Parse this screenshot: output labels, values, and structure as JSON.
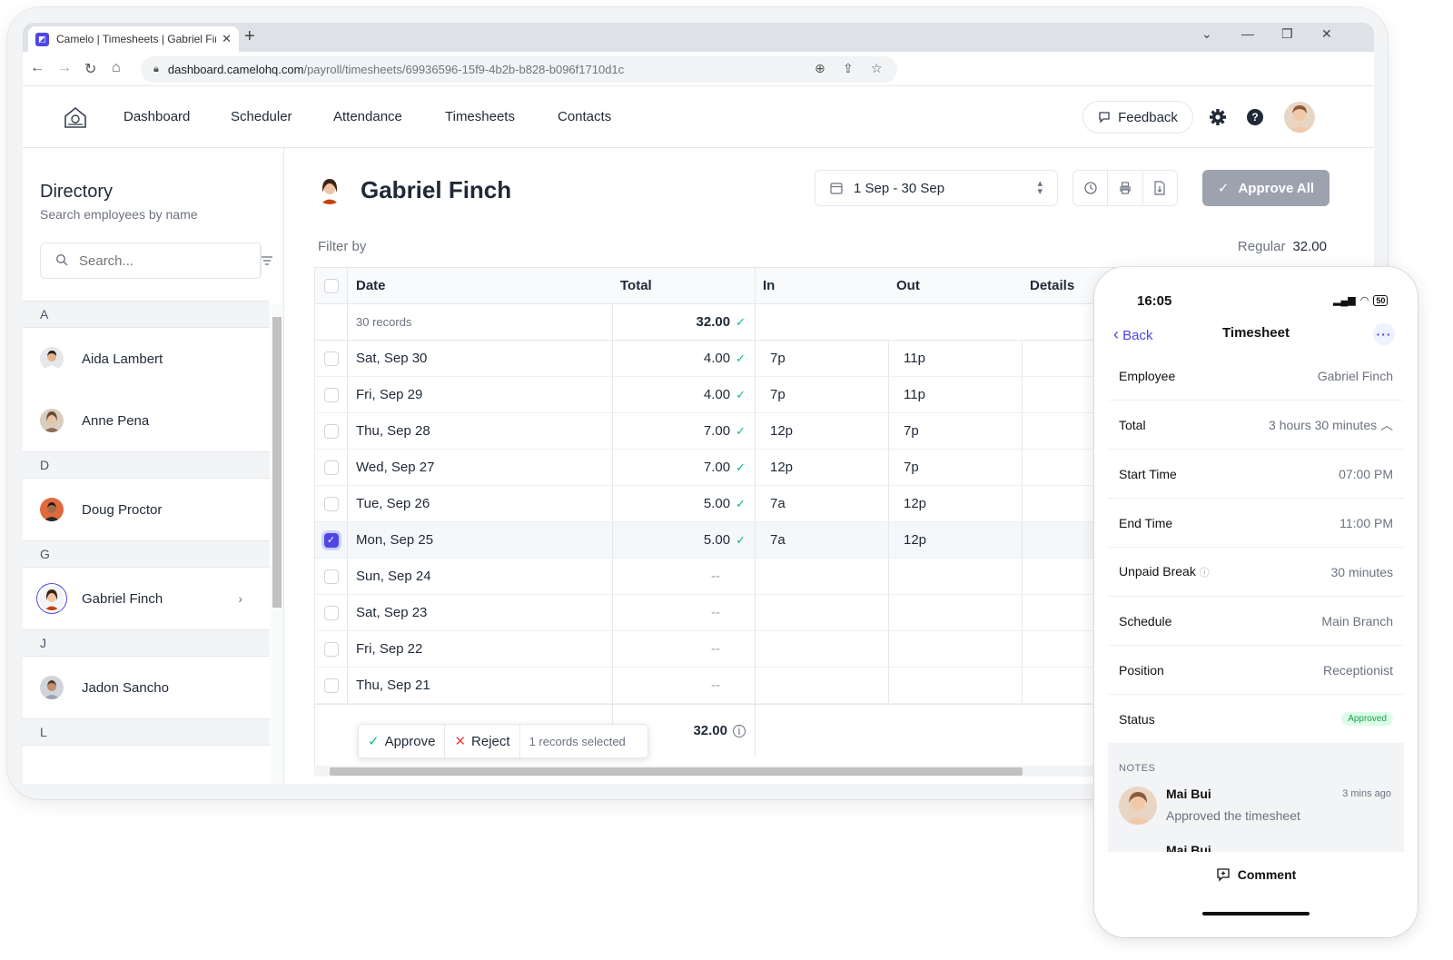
{
  "browser": {
    "tab_title": "Camelo | Timesheets | Gabriel Fin",
    "url_host": "dashboard.camelohq.com",
    "url_path": "/payroll/timesheets/69936596-15f9-4b2b-b828-b096f1710d1c"
  },
  "nav": {
    "items": [
      "Dashboard",
      "Scheduler",
      "Attendance",
      "Timesheets",
      "Contacts"
    ],
    "feedback": "Feedback"
  },
  "directory": {
    "title": "Directory",
    "subtitle": "Search employees by name",
    "search_placeholder": "Search...",
    "groups": [
      {
        "letter": "A",
        "people": [
          "Aida Lambert",
          "Anne Pena"
        ]
      },
      {
        "letter": "D",
        "people": [
          "Doug Proctor"
        ]
      },
      {
        "letter": "G",
        "people": [
          "Gabriel Finch"
        ]
      },
      {
        "letter": "J",
        "people": [
          "Jadon Sancho"
        ]
      },
      {
        "letter": "L",
        "people": []
      }
    ]
  },
  "employee": {
    "name": "Gabriel Finch",
    "date_range": "1 Sep - 30 Sep",
    "approve_all": "Approve All",
    "filter_by": "Filter by",
    "regular_label": "Regular",
    "regular_value": "32.00"
  },
  "table": {
    "headers": {
      "date": "Date",
      "total": "Total",
      "in": "In",
      "out": "Out",
      "details": "Details"
    },
    "summary": {
      "records": "30 records",
      "total": "32.00"
    },
    "rows": [
      {
        "date": "Sat, Sep 30",
        "total": "4.00",
        "in": "7p",
        "out": "11p"
      },
      {
        "date": "Fri, Sep 29",
        "total": "4.00",
        "in": "7p",
        "out": "11p"
      },
      {
        "date": "Thu, Sep 28",
        "total": "7.00",
        "in": "12p",
        "out": "7p"
      },
      {
        "date": "Wed, Sep 27",
        "total": "7.00",
        "in": "12p",
        "out": "7p"
      },
      {
        "date": "Tue, Sep 26",
        "total": "5.00",
        "in": "7a",
        "out": "12p"
      },
      {
        "date": "Mon, Sep 25",
        "total": "5.00",
        "in": "7a",
        "out": "12p"
      },
      {
        "date": "Sun, Sep 24",
        "total": "--",
        "in": "",
        "out": ""
      },
      {
        "date": "Sat, Sep 23",
        "total": "--",
        "in": "",
        "out": ""
      },
      {
        "date": "Fri, Sep 22",
        "total": "--",
        "in": "",
        "out": ""
      },
      {
        "date": "Thu, Sep 21",
        "total": "--",
        "in": "",
        "out": ""
      }
    ],
    "selected_row": "Mon, Sep 25",
    "footer_total": "32.00"
  },
  "bulk": {
    "approve": "Approve",
    "reject": "Reject",
    "selected": "1 records selected"
  },
  "phone": {
    "time": "16:05",
    "battery": "50",
    "back": "Back",
    "title": "Timesheet",
    "fields": [
      {
        "label": "Employee",
        "value": "Gabriel Finch"
      },
      {
        "label": "Total",
        "value": "3 hours 30 minutes"
      },
      {
        "label": "Start Time",
        "value": "07:00 PM"
      },
      {
        "label": "End Time",
        "value": "11:00 PM"
      },
      {
        "label": "Unpaid Break",
        "value": "30 minutes"
      },
      {
        "label": "Schedule",
        "value": "Main Branch"
      },
      {
        "label": "Position",
        "value": "Receptionist"
      },
      {
        "label": "Status",
        "value": "Approved"
      }
    ],
    "notes_heading": "NOTES",
    "note": {
      "author": "Mai Bui",
      "time": "3 mins ago",
      "text": "Approved the timesheet"
    },
    "note2_author": "Mai Bui",
    "comment": "Comment"
  },
  "colors": {
    "accent": "#4f46e5",
    "success": "#10b981",
    "danger": "#ef4444",
    "approve_all_bg": "#9ca3af"
  }
}
